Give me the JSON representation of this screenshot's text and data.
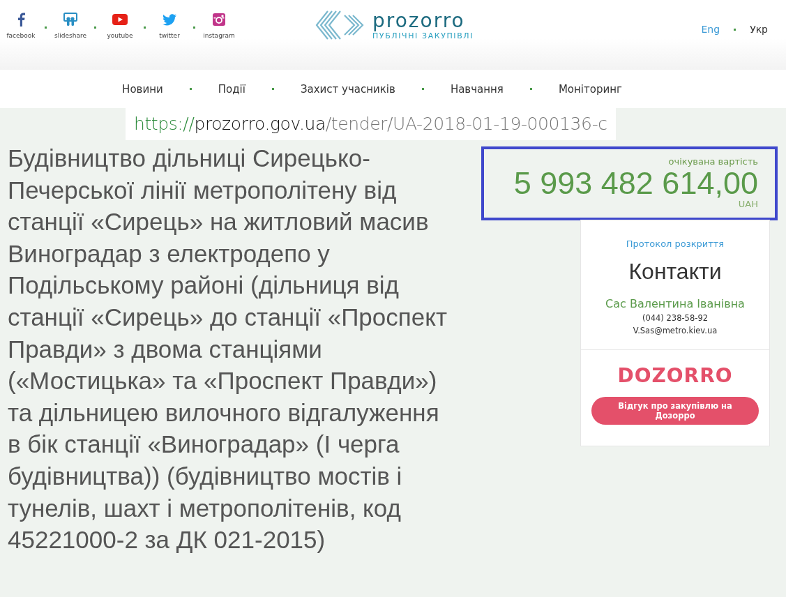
{
  "social": [
    {
      "kind": "facebook",
      "label": "facebook"
    },
    {
      "kind": "slideshare",
      "label": "slideshare"
    },
    {
      "kind": "youtube",
      "label": "youtube"
    },
    {
      "kind": "twitter",
      "label": "twitter"
    },
    {
      "kind": "instagram",
      "label": "instagram"
    }
  ],
  "logo": {
    "name": "prozorro",
    "tagline": "ПУБЛІЧНІ ЗАКУПІВЛІ"
  },
  "languages": [
    {
      "label": "Eng",
      "selected": false
    },
    {
      "label": "Укр",
      "selected": true
    }
  ],
  "nav": [
    "Новини",
    "Події",
    "Захист учасників",
    "Навчання",
    "Моніторинг"
  ],
  "url_bar": {
    "scheme": "https://",
    "host": "prozorro.gov.ua",
    "path": "/tender/UA-2018-01-19-000136-c"
  },
  "tender_title": "Будівництво дільниці Сирецько-Печерської лінії метрополітену від станції «Сирець» на житловий масив Виноградар з електродепо у Подільському районі (дільниця від станції «Сирець» до станції «Проспект Правди» з двома станціями («Мостицька» та «Проспект Правди») та дільницею вилочного відгалуження в бік станції «Виноградар» (І черга будівництва)) (будівництво мостів і тунелів, шахт і метрополітенів, код 45221000-2 за ДК 021-2015)",
  "expected_value": {
    "label": "очікувана вартість",
    "amount": "5 993 482 614,00",
    "currency": "UAH"
  },
  "sidebar": {
    "protocol_link": "Протокол розкриття",
    "contacts_heading": "Контакти",
    "contact_name": "Сас Валентина Іванівна",
    "phone": "(044) 238-58-92",
    "email": "V.Sas@metro.kiev.ua",
    "dozorro_logo": "DOZORRO",
    "dozorro_button": "Відгук про закупівлю на Дозорро"
  }
}
